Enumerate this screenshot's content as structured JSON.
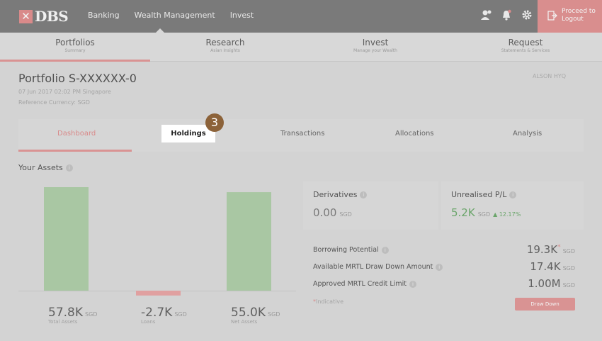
{
  "topbar": {
    "brand": "DBS",
    "nav": [
      "Banking",
      "Wealth Management",
      "Invest"
    ],
    "icons": [
      "user-settings-icon",
      "bell-icon",
      "gear-icon"
    ],
    "logout": {
      "line1": "Proceed to",
      "line2": "Logout"
    }
  },
  "subnav": [
    {
      "title": "Portfolios",
      "sub": "Summary"
    },
    {
      "title": "Research",
      "sub": "Asian Insights"
    },
    {
      "title": "Invest",
      "sub": "Manage your Wealth"
    },
    {
      "title": "Request",
      "sub": "Statements & Services"
    }
  ],
  "portfolio": {
    "title": "Portfolio S-XXXXXX-0",
    "date": "07 Jun 2017 02:02 PM Singapore",
    "currency": "Reference Currency: SGD",
    "user": "ALSON HYQ"
  },
  "tabs": [
    "Dashboard",
    "Holdings",
    "Transactions",
    "Allocations",
    "Analysis"
  ],
  "step_badge": "3",
  "assets": {
    "title": "Your Assets",
    "items": [
      {
        "value": "57.8K",
        "unit": "SGD",
        "label": "Total Assets"
      },
      {
        "value": "-2.7K",
        "unit": "SGD",
        "label": "Loans"
      },
      {
        "value": "55.0K",
        "unit": "SGD",
        "label": "Net Assets"
      }
    ],
    "bar_values": [
      57.8,
      -2.7,
      55.0
    ],
    "colors": {
      "positive": "#a9c7a3",
      "negative": "#e0a0a0"
    }
  },
  "derivatives": {
    "title": "Derivatives",
    "value": "0.00",
    "unit": "SGD"
  },
  "unrealised": {
    "title": "Unrealised P/L",
    "value": "5.2K",
    "unit": "SGD",
    "change": "▲ 12.17%"
  },
  "metrics": [
    {
      "label": "Borrowing Potential",
      "value": "19.3K",
      "star": "*",
      "unit": "SGD"
    },
    {
      "label": "Available MRTL Draw Down Amount",
      "value": "17.4K",
      "star": "",
      "unit": "SGD"
    },
    {
      "label": "Approved MRTL Credit Limit",
      "value": "1.00M",
      "star": "",
      "unit": "SGD"
    }
  ],
  "indicative": "Indicative",
  "draw_down": "Draw Down"
}
